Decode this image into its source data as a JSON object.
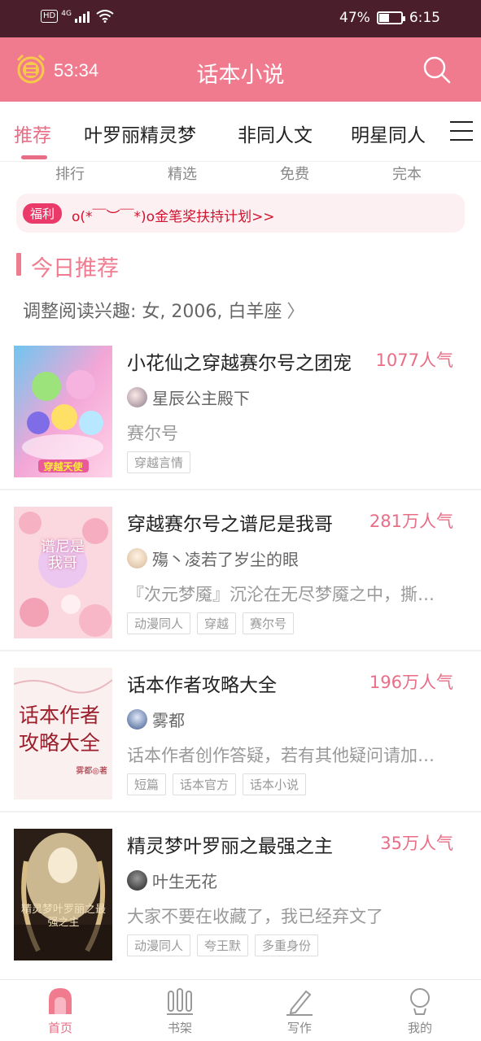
{
  "status_bar": {
    "network": "HD",
    "network_type": "4G",
    "battery": "47%",
    "battery_level": 0.47,
    "time": "6:15"
  },
  "app_bar": {
    "timer": "53:34",
    "title": "话本小说"
  },
  "tabs": [
    "推荐",
    "叶罗丽精灵梦",
    "非同人文",
    "明星同人"
  ],
  "active_tab": 0,
  "subnav": [
    "排行",
    "精选",
    "免费",
    "完本"
  ],
  "banner": {
    "badge": "福利",
    "text": "o(*￣︶￣*)o金笔奖扶持计划>>"
  },
  "section": {
    "title": "今日推荐",
    "interest": "调整阅读兴趣: 女, 2006, 白羊座"
  },
  "books": [
    {
      "title": "小花仙之穿越赛尔号之团宠",
      "popularity": "1077人气",
      "author": "星辰公主殿下",
      "description": "赛尔号",
      "tags": [
        "穿越言情"
      ],
      "cover_text": "穿越天使"
    },
    {
      "title": "穿越赛尔号之谱尼是我哥",
      "popularity": "281万人气",
      "author": "殤丶凌若了岁尘的眼",
      "description": "『次元梦魇』沉沦在无尽梦魇之中，撕…",
      "tags": [
        "动漫同人",
        "穿越",
        "赛尔号"
      ],
      "cover_text": "谱尼是我哥"
    },
    {
      "title": "话本作者攻略大全",
      "popularity": "196万人气",
      "author": "雾都",
      "description": "话本作者创作答疑，若有其他疑问请加…",
      "tags": [
        "短篇",
        "话本官方",
        "话本小说"
      ],
      "cover_text": "话本作者攻略大全",
      "cover_sub": "雾都◎著"
    },
    {
      "title": "精灵梦叶罗丽之最强之主",
      "popularity": "35万人气",
      "author": "叶生无花",
      "description": "大家不要在收藏了，我已经弃文了",
      "tags": [
        "动漫同人",
        "夸王默",
        "多重身份"
      ],
      "cover_text": "精灵梦叶罗丽之最强之主"
    }
  ],
  "bottom_nav": [
    "首页",
    "书架",
    "写作",
    "我的"
  ],
  "active_nav": 0,
  "colors": {
    "status_bar": "#4a1f2b",
    "primary": "#f07b8f",
    "accent": "#e96d86",
    "banner_text": "#d2122e"
  }
}
